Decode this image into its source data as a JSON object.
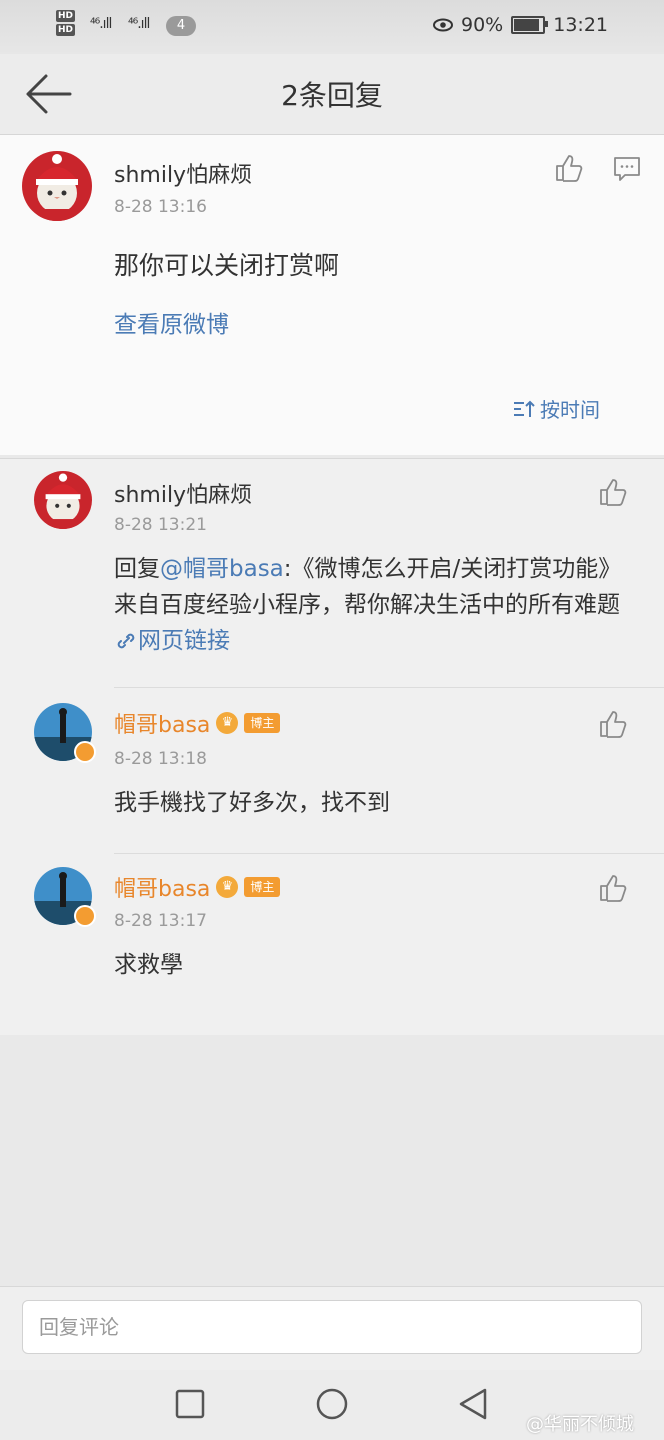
{
  "status_bar": {
    "hd1": "HD",
    "hd2": "HD",
    "signal1": "⁴⁶.ıll",
    "signal2": "⁴⁶.ıll",
    "notification_count": "4",
    "battery_percent": "90%",
    "battery_level": 0.9,
    "time": "13:21"
  },
  "header": {
    "title": "2条回复"
  },
  "main_comment": {
    "username": "shmily怕麻烦",
    "time": "8-28 13:16",
    "text": "那你可以关闭打赏啊",
    "view_original": "查看原微博",
    "sort_label": "按时间"
  },
  "replies": [
    {
      "username": "shmily怕麻烦",
      "time": "8-28 13:21",
      "reply_prefix": "回复",
      "mention": "@帽哥basa",
      "text_after_mention": ":《微博怎么开启/关闭打赏功能》来自百度经验小程序，帮你解决生活中的所有难题",
      "link_text": "网页链接"
    },
    {
      "username": "帽哥basa",
      "badge": "博主",
      "time": "8-28 13:18",
      "text": "我手機找了好多次，找不到"
    },
    {
      "username": "帽哥basa",
      "badge": "博主",
      "time": "8-28 13:17",
      "text": "求救學"
    }
  ],
  "input": {
    "placeholder": "回复评论"
  },
  "watermark": "@华丽不倾城",
  "colors": {
    "link": "#4b7bb5",
    "orange_name": "#e8862b",
    "badge": "#f39c31"
  }
}
